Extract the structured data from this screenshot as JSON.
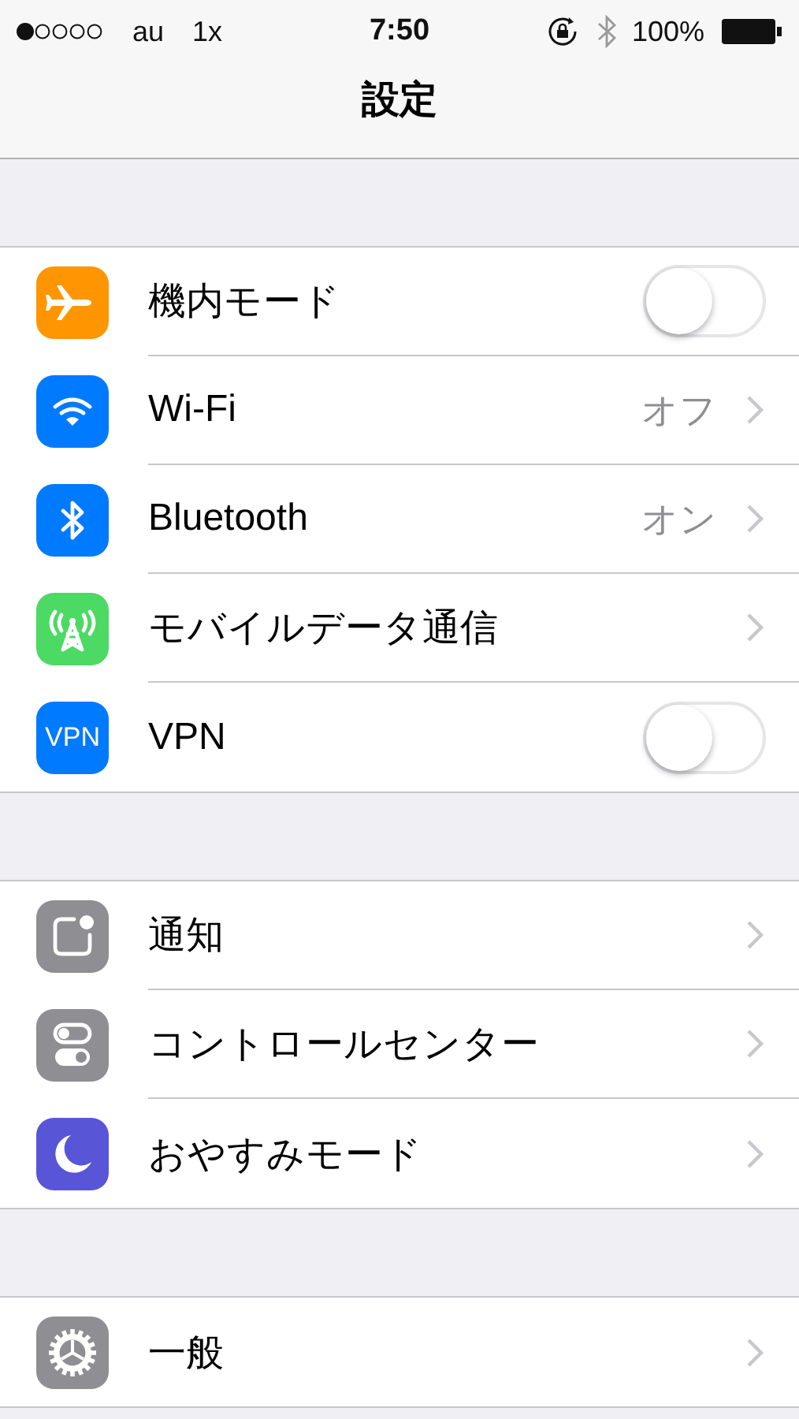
{
  "status_bar": {
    "carrier": "au",
    "network": "1x",
    "time": "7:50",
    "battery": "100%"
  },
  "nav": {
    "title": "設定"
  },
  "groups": [
    {
      "rows": [
        {
          "kind": "toggle",
          "label": "機内モード",
          "color": "#ff9500",
          "on": false
        },
        {
          "kind": "link",
          "label": "Wi-Fi",
          "color": "#007aff",
          "value": "オフ"
        },
        {
          "kind": "link",
          "label": "Bluetooth",
          "color": "#007aff",
          "value": "オン"
        },
        {
          "kind": "link",
          "label": "モバイルデータ通信",
          "color": "#4cd964"
        },
        {
          "kind": "toggle",
          "label": "VPN",
          "color": "#007aff",
          "icon_text": "VPN",
          "on": false
        }
      ]
    },
    {
      "rows": [
        {
          "kind": "link",
          "label": "通知",
          "color": "#8e8e93"
        },
        {
          "kind": "link",
          "label": "コントロールセンター",
          "color": "#8e8e93"
        },
        {
          "kind": "link",
          "label": "おやすみモード",
          "color": "#5856d6"
        }
      ]
    },
    {
      "rows": [
        {
          "kind": "link",
          "label": "一般",
          "color": "#8e8e93"
        }
      ]
    }
  ]
}
